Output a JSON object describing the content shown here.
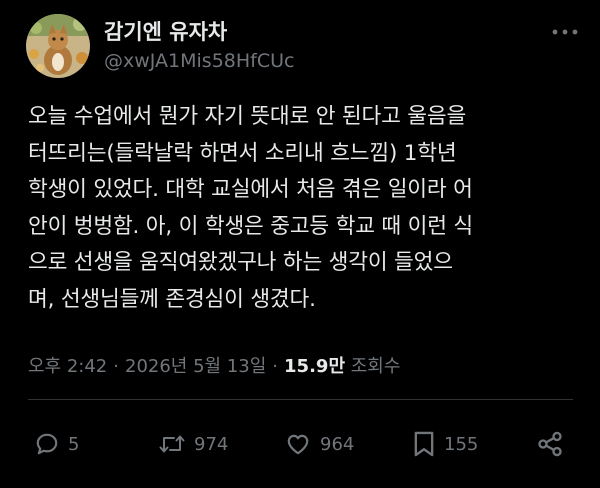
{
  "author": {
    "display_name": "감기엔 유자차",
    "handle": "@xwJA1Mis58HfCUc"
  },
  "tweet": {
    "text": "오늘 수업에서  뭔가 자기 뜻대로 안 된다고 울음을\n터뜨리는(들락날락 하면서 소리내 흐느낌) 1학년\n학생이 있었다. 대학 교실에서 처음 겪은 일이라 어\n안이 벙벙함. 아, 이 학생은 중고등 학교 때 이런 식\n으로 선생을 움직여왔겠구나 하는 생각이 들었으\n며, 선생님들께 존경심이 생겼다."
  },
  "meta": {
    "time": "오후 2:42",
    "separator": "·",
    "date": "2026년 5월 13일",
    "views_count": "15.9만",
    "views_label": "조회수"
  },
  "actions": {
    "replies": "5",
    "retweets": "974",
    "likes": "964",
    "bookmarks": "155"
  },
  "icons": {
    "more": "more-options-icon",
    "reply": "reply-icon",
    "retweet": "retweet-icon",
    "like": "heart-icon",
    "bookmark": "bookmark-icon",
    "share": "share-icon"
  },
  "colors": {
    "background": "#000000",
    "text_primary": "#e7e9ea",
    "text_secondary": "#71767b",
    "divider": "#2f3336"
  }
}
